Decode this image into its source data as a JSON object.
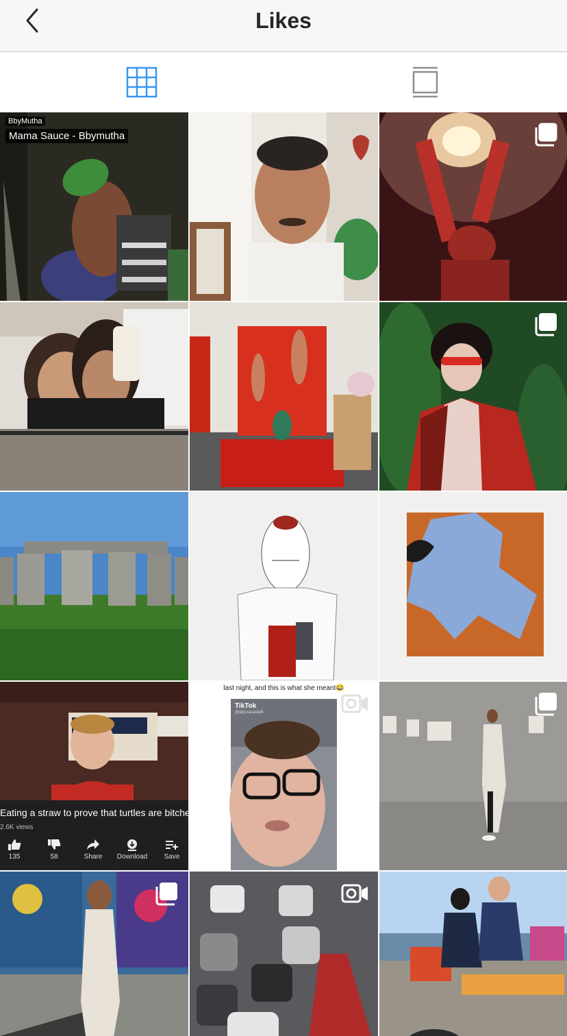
{
  "header": {
    "title": "Likes"
  },
  "tabs": [
    {
      "name": "grid-view",
      "active": true,
      "color": "#3897f0"
    },
    {
      "name": "feed-view",
      "active": false,
      "color": "#8e8e8e"
    }
  ],
  "accent": "#3897f0",
  "tiles": [
    {
      "id": 1,
      "badge": null,
      "tag": "BbyMutha",
      "song": "Mama Sauce - Bbymutha"
    },
    {
      "id": 2,
      "badge": null
    },
    {
      "id": 3,
      "badge": "carousel-icon"
    },
    {
      "id": 4,
      "badge": null
    },
    {
      "id": 5,
      "badge": null
    },
    {
      "id": 6,
      "badge": "carousel-icon"
    },
    {
      "id": 7,
      "badge": null
    },
    {
      "id": 8,
      "badge": null
    },
    {
      "id": 9,
      "badge": null
    },
    {
      "id": 10,
      "badge": null,
      "youtube": {
        "title": "Eating a straw to prove that turtles are bitches",
        "views": "2.6K views",
        "actions": [
          "135",
          "58",
          "Share",
          "Download",
          "Save"
        ]
      }
    },
    {
      "id": 11,
      "badge": "video-icon",
      "tiktok": {
        "caption": "last night, and this is what she meant😂",
        "logo": "TikTok",
        "handle": "@alyssacastelli"
      }
    },
    {
      "id": 12,
      "badge": "carousel-icon"
    },
    {
      "id": 13,
      "badge": "carousel-icon"
    },
    {
      "id": 14,
      "badge": "video-icon"
    },
    {
      "id": 15,
      "badge": null
    }
  ]
}
